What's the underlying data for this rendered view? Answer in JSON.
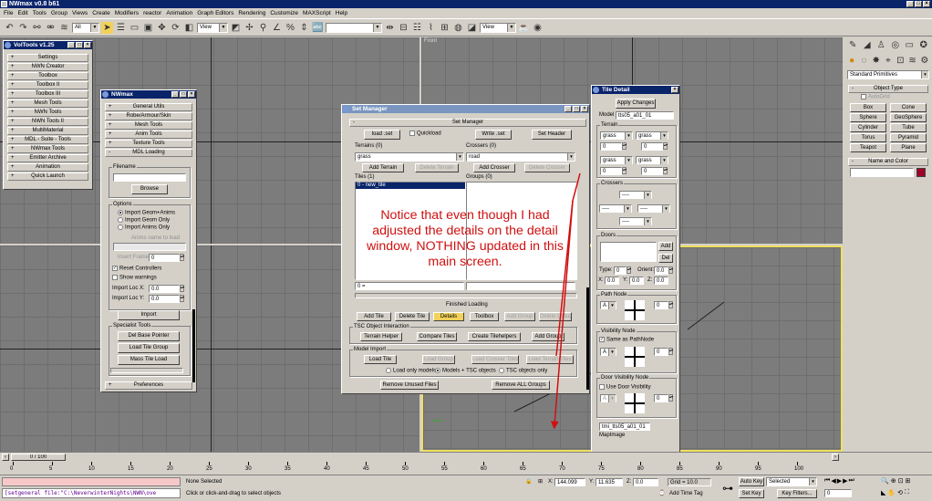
{
  "app": {
    "title": "NWmax v0.8 b61"
  },
  "menu": [
    "File",
    "Edit",
    "Tools",
    "Group",
    "Views",
    "Create",
    "Modifiers",
    "reactor",
    "Animation",
    "Graph Editors",
    "Rendering",
    "Customize",
    "MAXScript",
    "Help"
  ],
  "toolbar": {
    "selection_filter": "All",
    "ref_coord": "View",
    "ref_coord2": "View"
  },
  "viewports": {
    "front_label": "Front"
  },
  "voltools": {
    "title": "VolTools v1.25",
    "items": [
      "Settings",
      "NWN Creator",
      "Toolbox",
      "Toolbox II",
      "Toolbox III",
      "Mesh Tools",
      "NWN Tools",
      "NWN Tools II",
      "MultiMaterial",
      "MDL - Suite - Tools",
      "NWmax Tools",
      "Emitter Archive",
      "Animation",
      "Quick Launch"
    ]
  },
  "nwmax": {
    "title": "NWmax",
    "rollouts": [
      "General Utils",
      "Robe/Armour/Skin",
      "Mesh Tools",
      "Anim Tools",
      "Texture Tools"
    ],
    "mdl_loading": "MDL Loading",
    "filename_label": "Filename",
    "browse": "Browse",
    "options_label": "Options",
    "radios": [
      "Import Geom+Anims",
      "Import Geom Only",
      "Import Anims Only"
    ],
    "anims_name_label": "Anims name to load",
    "insert_frame_label": "Insert Frame",
    "insert_frame_value": "0",
    "reset_controllers": "Reset Controllers",
    "show_warnings": "Show warnings",
    "import_loc_x": "Import Loc X:",
    "import_loc_x_val": "0.0",
    "import_loc_y": "Import Loc Y:",
    "import_loc_y_val": "0.0",
    "import": "Import",
    "specialist_label": "Specialist Tools",
    "specialist": [
      "Del Base Pointer",
      "Load Tile Group",
      "Mass Tile Load"
    ],
    "preferences": "Preferences"
  },
  "setmanager": {
    "title": "Set Manager",
    "section": "Set Manager",
    "load_set": "load .set",
    "quickload": "Quickload",
    "write_set": "Write .set",
    "set_header": "Set Header",
    "terrains_label": "Terrains (0)",
    "crossers_label": "Crossers (0)",
    "terrain_value": "grass",
    "crosser_value": "road",
    "add_terrain": "Add Terrain",
    "delete_terrain": "Delete Terrain",
    "add_crosser": "Add Crosser",
    "delete_crosser": "Delete Crosser",
    "tiles_label": "Tiles (1)",
    "groups_label": "Groups (0)",
    "tile_item": "0 - new_tile",
    "tile_field": "0 =",
    "status": "Finished Loading",
    "add_tile": "Add Tile",
    "delete_tile": "Delete Tile",
    "details": "Details",
    "toolbox": "Toolbox",
    "add_group": "Add Group",
    "delete_group": "Delete Group",
    "tsc_label": "TSC Object Interaction",
    "terrain_helper": "Terrain Helper",
    "compare_tiles": "Compare Tiles",
    "create_tilehelpers": "Create Tilehelpers",
    "add_group2": "Add Group",
    "model_import_label": "Model Import",
    "load_tile": "Load Tile",
    "load_group": "Load Group",
    "load_crosser_tiles": "Load Crosser Tiles",
    "load_terrain_tiles": "Load Terrain Tiles",
    "radio_load_only": "Load only models",
    "radio_models_tsc": "Models + TSC objects",
    "radio_tsc_only": "TSC objects only",
    "remove_unused": "Remove Unused Files",
    "remove_all_groups": "Remove ALL Groups"
  },
  "tiledetail": {
    "title": "Tile Detail",
    "apply": "Apply Changes",
    "model_label": "Model",
    "model_value": "tts05_a01_01",
    "terrain_label": "Terrain",
    "t1": "grass",
    "t2": "grass",
    "t3": "grass",
    "t4": "grass",
    "h1": "0",
    "h2": "0",
    "h3": "0",
    "h4": "0",
    "crossers_label": "Crossers",
    "c_dash": "----",
    "doors_label": "Doors",
    "add": "Add",
    "del": "Del",
    "type_label": "Type:",
    "type_val": "0",
    "orient_label": "Orient:",
    "orient_val": "0.0",
    "x_label": "X:",
    "x_val": "0.0",
    "y_label": "Y:",
    "y_val": "0.0",
    "z_label": "Z:",
    "z_val": "0.0",
    "pathnode_label": "Path Node",
    "pathnode_val": "A",
    "pn_spin": "0",
    "visnode_label": "Visibility Node",
    "same_as_path": "Same as PathNode",
    "vis_val": "A",
    "vis_spin": "0",
    "doorvis_label": "Door Visibility Node",
    "use_door_vis": "Use Door Visibility",
    "dv_val": "A",
    "dv_spin": "0",
    "mapimage_value": "tmi_tts05_a01_01",
    "mapimage_label": "MapImage"
  },
  "cmdpanel": {
    "dropdown": "Standard Primitives",
    "object_type": "Object Type",
    "autogrid": "AutoGrid",
    "buttons": [
      "Box",
      "Cone",
      "Sphere",
      "GeoSphere",
      "Cylinder",
      "Tube",
      "Torus",
      "Pyramid",
      "Teapot",
      "Plane"
    ],
    "name_color": "Name and Color"
  },
  "annotation": "Notice that even though I had adjusted the details on the detail window, NOTHING updated in this main screen.",
  "timeline": {
    "counter": "0 / 100",
    "ticks": [
      "0",
      "5",
      "10",
      "15",
      "20",
      "25",
      "30",
      "35",
      "40",
      "45",
      "50",
      "55",
      "60",
      "65",
      "70",
      "75",
      "80",
      "85",
      "90",
      "95",
      "100"
    ]
  },
  "status": {
    "script": "[setgeneral file:\"C:\\NeverwinterNights\\NWN\\ove",
    "none_selected": "None Selected",
    "prompt": "Click or click-and-drag to select objects",
    "x_label": "X:",
    "x_val": "144.099",
    "y_label": "Y:",
    "y_val": "11.635",
    "z_label": "Z:",
    "z_val": "0.0",
    "grid": "Grid = 10.0",
    "add_time_tag": "Add Time Tag",
    "auto_key": "Auto Key",
    "set_key": "Set Key",
    "selected": "Selected",
    "key_filters": "Key Filters...",
    "frame": "0"
  }
}
